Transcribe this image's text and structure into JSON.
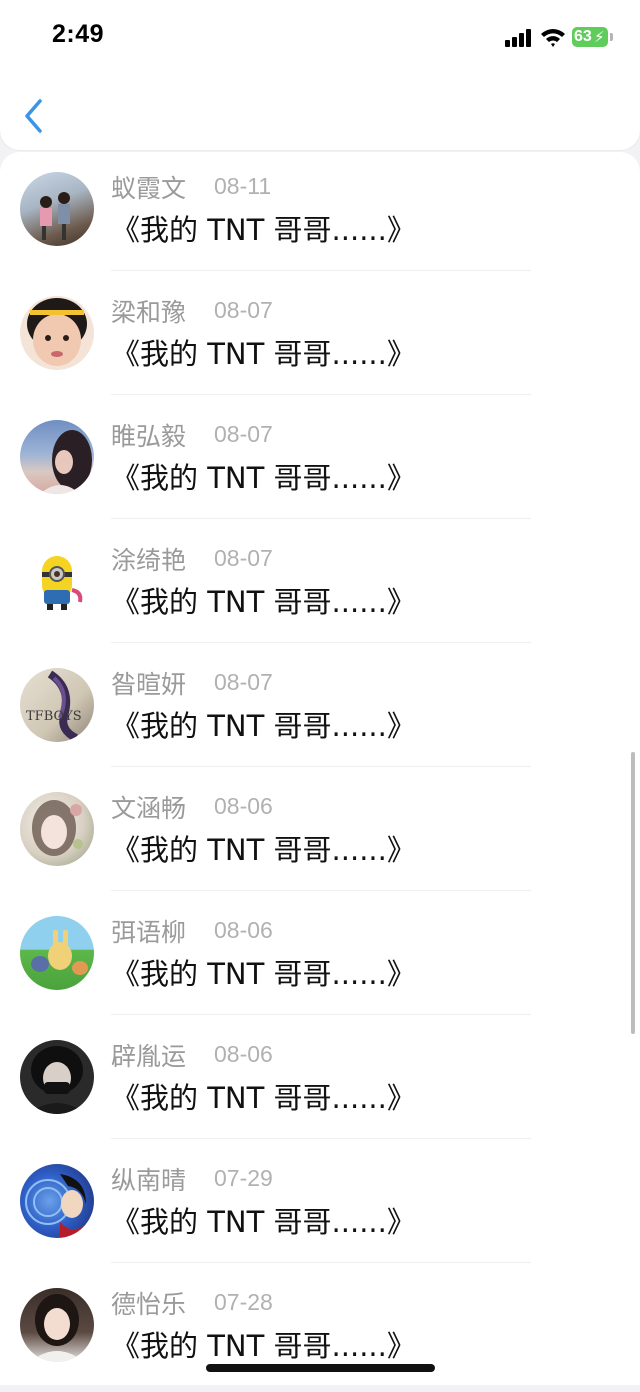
{
  "status_bar": {
    "time": "2:49",
    "battery": "63",
    "battery_color": "#5fcc5c"
  },
  "nav": {
    "back_icon": "chevron-left-icon",
    "accent_color": "#3b94e8"
  },
  "messages": [
    {
      "name": "蚁霞文",
      "date": "08-11",
      "text": "《我的 TNT 哥哥......》",
      "avatar": "children-photo-avatar"
    },
    {
      "name": "梁和豫",
      "date": "08-07",
      "text": "《我的 TNT 哥哥......》",
      "avatar": "baby-girl-avatar"
    },
    {
      "name": "睢弘毅",
      "date": "08-07",
      "text": "《我的 TNT 哥哥......》",
      "avatar": "girl-sky-avatar"
    },
    {
      "name": "涂绮艳",
      "date": "08-07",
      "text": "《我的 TNT 哥哥......》",
      "avatar": "minion-avatar"
    },
    {
      "name": "昝暄妍",
      "date": "08-07",
      "text": "《我的 TNT 哥哥......》",
      "avatar": "tfboys-avatar",
      "avatar_text": "TFBOYS"
    },
    {
      "name": "文涵畅",
      "date": "08-06",
      "text": "《我的 TNT 哥哥......》",
      "avatar": "flower-girl-avatar"
    },
    {
      "name": "弭语柳",
      "date": "08-06",
      "text": "《我的 TNT 哥哥......》",
      "avatar": "cartoon-rabbit-avatar"
    },
    {
      "name": "辟胤运",
      "date": "08-06",
      "text": "《我的 TNT 哥哥......》",
      "avatar": "masked-person-avatar"
    },
    {
      "name": "纵南晴",
      "date": "07-29",
      "text": "《我的 TNT 哥哥......》",
      "avatar": "anime-ninja-avatar"
    },
    {
      "name": "德怡乐",
      "date": "07-28",
      "text": "《我的 TNT 哥哥......》",
      "avatar": "woman-portrait-avatar"
    }
  ]
}
